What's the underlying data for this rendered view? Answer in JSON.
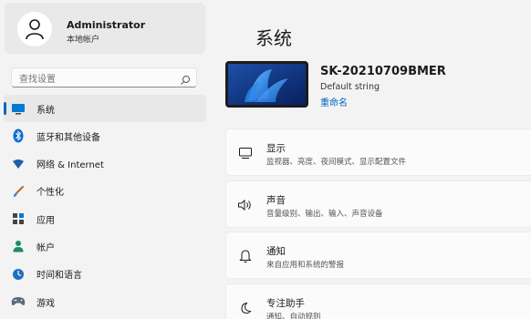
{
  "account": {
    "name": "Administrator",
    "type": "本地帐户",
    "avatar_icon": "person-icon"
  },
  "search": {
    "placeholder": "查找设置",
    "icon": "search-icon"
  },
  "sidebar": {
    "items": [
      {
        "label": "系统",
        "icon": "monitor-icon",
        "active": true
      },
      {
        "label": "蓝牙和其他设备",
        "icon": "bluetooth-icon",
        "active": false
      },
      {
        "label": "网络 & Internet",
        "icon": "wifi-icon",
        "active": false
      },
      {
        "label": "个性化",
        "icon": "brush-icon",
        "active": false
      },
      {
        "label": "应用",
        "icon": "apps-icon",
        "active": false
      },
      {
        "label": "帐户",
        "icon": "account-icon",
        "active": false
      },
      {
        "label": "时间和语言",
        "icon": "globe-clock-icon",
        "active": false
      },
      {
        "label": "游戏",
        "icon": "gamepad-icon",
        "active": false
      }
    ]
  },
  "main": {
    "title": "系统",
    "device": {
      "name": "SK-20210709BMER",
      "subtitle": "Default string",
      "rename_label": "重命名"
    },
    "cards": [
      {
        "title": "显示",
        "desc": "监视器、亮度、夜间模式、显示配置文件",
        "icon": "display-icon"
      },
      {
        "title": "声音",
        "desc": "音量级别、输出、输入、声音设备",
        "icon": "speaker-icon"
      },
      {
        "title": "通知",
        "desc": "来自应用和系统的警报",
        "icon": "bell-icon"
      },
      {
        "title": "专注助手",
        "desc": "通知、自动规则",
        "icon": "moon-icon"
      }
    ]
  },
  "colors": {
    "accent": "#0067c0",
    "background": "#f3f3f3",
    "card": "#fbfbfb"
  }
}
